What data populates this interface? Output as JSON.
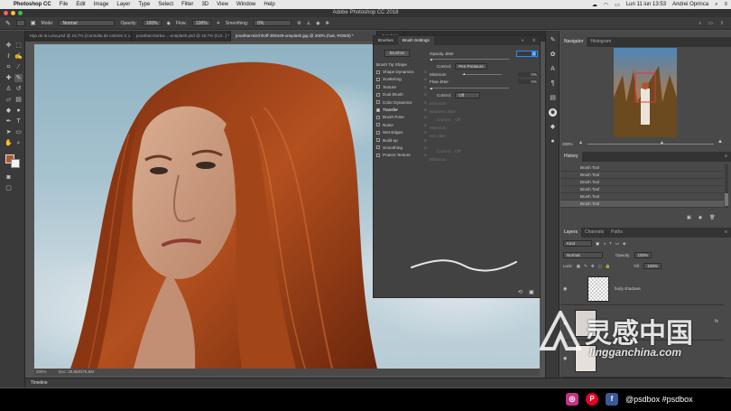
{
  "menubar": {
    "app": "Photoshop CC",
    "items": [
      "File",
      "Edit",
      "Image",
      "Layer",
      "Type",
      "Select",
      "Filter",
      "3D",
      "View",
      "Window",
      "Help"
    ],
    "clock": "Lun 11 iun 13:53",
    "user": "Andrei Oprinca"
  },
  "titlebar": {
    "title": "Adobe Photoshop CC 2018"
  },
  "optionsbar": {
    "mode_label": "Mode:",
    "mode_value": "Normal",
    "opacity_label": "Opacity:",
    "opacity_value": "100%",
    "flow_label": "Flow:",
    "flow_value": "100%",
    "smoothing_label": "Smoothing:",
    "smoothing_value": "0%"
  },
  "tabs": [
    {
      "label": "Hija de la Luna.psd @ 16,7% (Consulta de colores 3, Layer Mask/8) *"
    },
    {
      "label": "jonathan-borba-...-unsplash.psd @ 16,7% (Col...) *"
    },
    {
      "label": "jonathan-kirchhoff-308449-unsplash.jpg @ 200% (hair, RGB/8) *"
    },
    {
      "label": "Renderin"
    }
  ],
  "canvas": {
    "zoom": "200%",
    "doc": "Doc: 28,8M/376,8M"
  },
  "brush_settings": {
    "tabs": [
      "Brushes",
      "Brush Settings"
    ],
    "brushes_button": "Brushes",
    "items": [
      {
        "label": "Brush Tip Shape",
        "checkbox": false,
        "checked": false
      },
      {
        "label": "Shape Dynamics",
        "checkbox": true,
        "checked": false
      },
      {
        "label": "Scattering",
        "checkbox": true,
        "checked": false
      },
      {
        "label": "Texture",
        "checkbox": true,
        "checked": false
      },
      {
        "label": "Dual Brush",
        "checkbox": true,
        "checked": false
      },
      {
        "label": "Color Dynamics",
        "checkbox": true,
        "checked": false
      },
      {
        "label": "Transfer",
        "checkbox": true,
        "checked": true
      },
      {
        "label": "Brush Pose",
        "checkbox": true,
        "checked": false
      },
      {
        "label": "Noise",
        "checkbox": true,
        "checked": false
      },
      {
        "label": "Wet Edges",
        "checkbox": true,
        "checked": false
      },
      {
        "label": "Build-up",
        "checkbox": true,
        "checked": false
      },
      {
        "label": "Smoothing",
        "checkbox": true,
        "checked": false
      },
      {
        "label": "Protect Texture",
        "checkbox": true,
        "checked": false
      }
    ],
    "opacity_jitter_label": "Opacity Jitter",
    "opacity_jitter_value": 0,
    "control_label": "Control:",
    "control_value": "Pen Pressure",
    "minimum_label": "Minimum",
    "minimum_value": "0%",
    "flow_jitter_label": "Flow Jitter",
    "flow_jitter_value": "0%",
    "control2_value": "Off",
    "disabled": {
      "minimum": "Minimum",
      "wetness_jitter": "Wetness Jitter",
      "control": "Control:",
      "off": "Off",
      "mix_jitter": "Mix Jitter"
    }
  },
  "navigator": {
    "tabs": [
      "Navigator",
      "Histogram"
    ],
    "zoom": "200%"
  },
  "history": {
    "tab": "History",
    "items": [
      "Brush Tool",
      "Brush Tool",
      "Brush Tool",
      "Brush Tool",
      "Brush Tool",
      "Brush Tool"
    ],
    "selected_index": 5
  },
  "layers": {
    "tabs": [
      "Layers",
      "Channels",
      "Paths"
    ],
    "kind_value": "Kind",
    "blend_value": "Normal",
    "opacity_label": "Opacity:",
    "opacity_value": "100%",
    "lock_label": "Lock:",
    "fill_label": "Fill:",
    "fill_value": "100%",
    "rows": [
      {
        "name": "body shadows"
      },
      {
        "name": ""
      },
      {
        "name": "hair"
      }
    ]
  },
  "timeline": {
    "label": "Timeline"
  },
  "watermark": {
    "brand": "灵感中国",
    "url": "lingganchina.com"
  },
  "social": {
    "handle": "@psdbox #psdbox"
  },
  "colors": {
    "accent": "#2c8cf0",
    "foreground_swatch": "#b0562e"
  }
}
